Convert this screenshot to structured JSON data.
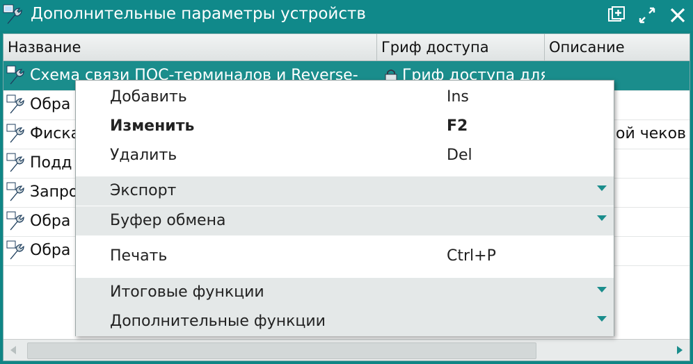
{
  "window": {
    "title": "Дополнительные параметры устройств",
    "title_icon": "wrench-icon",
    "buttons": [
      "new-window-icon",
      "maximize-icon",
      "close-icon"
    ]
  },
  "table": {
    "columns": [
      "Название",
      "Гриф доступа",
      "Описание"
    ],
    "rows": [
      {
        "name": "Схема связи ПОС-терминалов и Reverse-",
        "access": "Гриф доступа для",
        "description": "",
        "selected": true
      },
      {
        "name": "Обра",
        "access": "",
        "description": ""
      },
      {
        "name": "Фиска",
        "access": "",
        "description": "ой чеков"
      },
      {
        "name": "Подд",
        "access": "",
        "description": ""
      },
      {
        "name": "Запро",
        "access": "",
        "description": ""
      },
      {
        "name": "Обра",
        "access": "",
        "description": ""
      },
      {
        "name": "Обра",
        "access": "",
        "description": ""
      }
    ]
  },
  "context_menu": {
    "items": [
      {
        "label": "Добавить",
        "shortcut": "Ins"
      },
      {
        "label": "Изменить",
        "shortcut": "F2",
        "bold": true
      },
      {
        "label": "Удалить",
        "shortcut": "Del"
      },
      {
        "label": "Экспорт",
        "submenu": true
      },
      {
        "label": "Буфер обмена",
        "submenu": true
      },
      {
        "label": "Печать",
        "shortcut": "Ctrl+P"
      },
      {
        "label": "Итоговые функции",
        "submenu": true
      },
      {
        "label": "Дополнительные функции",
        "submenu": true
      }
    ]
  },
  "colors": {
    "titlebar": "#10898a",
    "selection": "#1a8d8c",
    "submenu_bg": "#e4e8e8"
  }
}
